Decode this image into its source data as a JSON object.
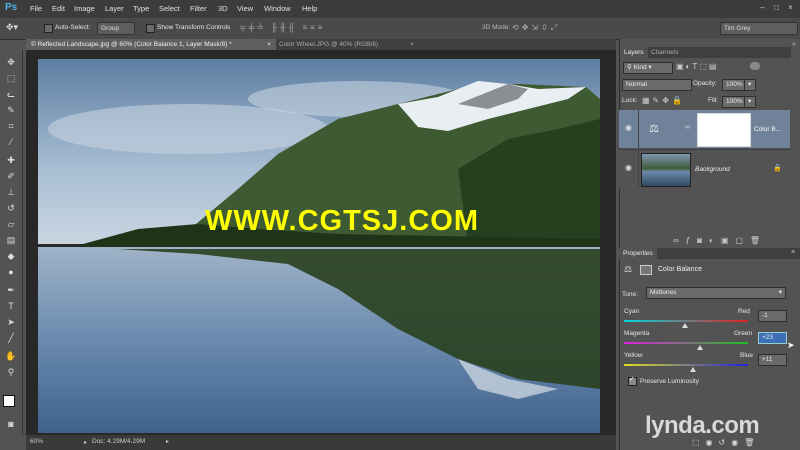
{
  "app": {
    "logo": "Ps"
  },
  "menu": [
    "File",
    "Edit",
    "Image",
    "Layer",
    "Type",
    "Select",
    "Filter",
    "3D",
    "View",
    "Window",
    "Help"
  ],
  "options_bar": {
    "auto_select_label": "Auto-Select:",
    "auto_select_value": "Group",
    "transform_label": "Show Transform Controls",
    "mode_3d_label": "3D Mode:",
    "workspace": "Tim Grey"
  },
  "tabs": [
    {
      "label": "© Reflected Landscape.jpg @ 60% (Color Balance 1, Layer Mask/8) *",
      "close": "×"
    },
    {
      "label": "Color Wheel.JPG @ 40% (RGB/8)",
      "close": "×"
    }
  ],
  "watermark": "WWW.CGTSJ.COM",
  "status": {
    "zoom": "60%",
    "doc": "Doc: 4.29M/4.29M"
  },
  "layers_panel": {
    "tabs": [
      "Layers",
      "Channels"
    ],
    "kind": "Kind",
    "blend_mode": "Normal",
    "opacity_label": "Opacity:",
    "opacity": "100%",
    "lock_label": "Lock:",
    "fill_label": "Fill:",
    "fill": "100%",
    "layers": [
      {
        "name": "Color B..."
      },
      {
        "name": "Background"
      }
    ]
  },
  "properties_panel": {
    "tab": "Properties",
    "title": "Color Balance",
    "tone_label": "Tone:",
    "tone": "Midtones",
    "sliders": [
      {
        "left": "Cyan",
        "right": "Red",
        "value": "-1",
        "amount": -1,
        "colors": [
          "#00d7e0",
          "#e02020"
        ]
      },
      {
        "left": "Magenta",
        "right": "Green",
        "value": "+23",
        "amount": 23,
        "colors": [
          "#e020e0",
          "#20c020"
        ]
      },
      {
        "left": "Yellow",
        "right": "Blue",
        "value": "+11",
        "amount": 11,
        "colors": [
          "#e0e020",
          "#2020e0"
        ]
      }
    ],
    "preserve_label": "Preserve Luminosity"
  },
  "branding": {
    "text": "lynda.com"
  }
}
